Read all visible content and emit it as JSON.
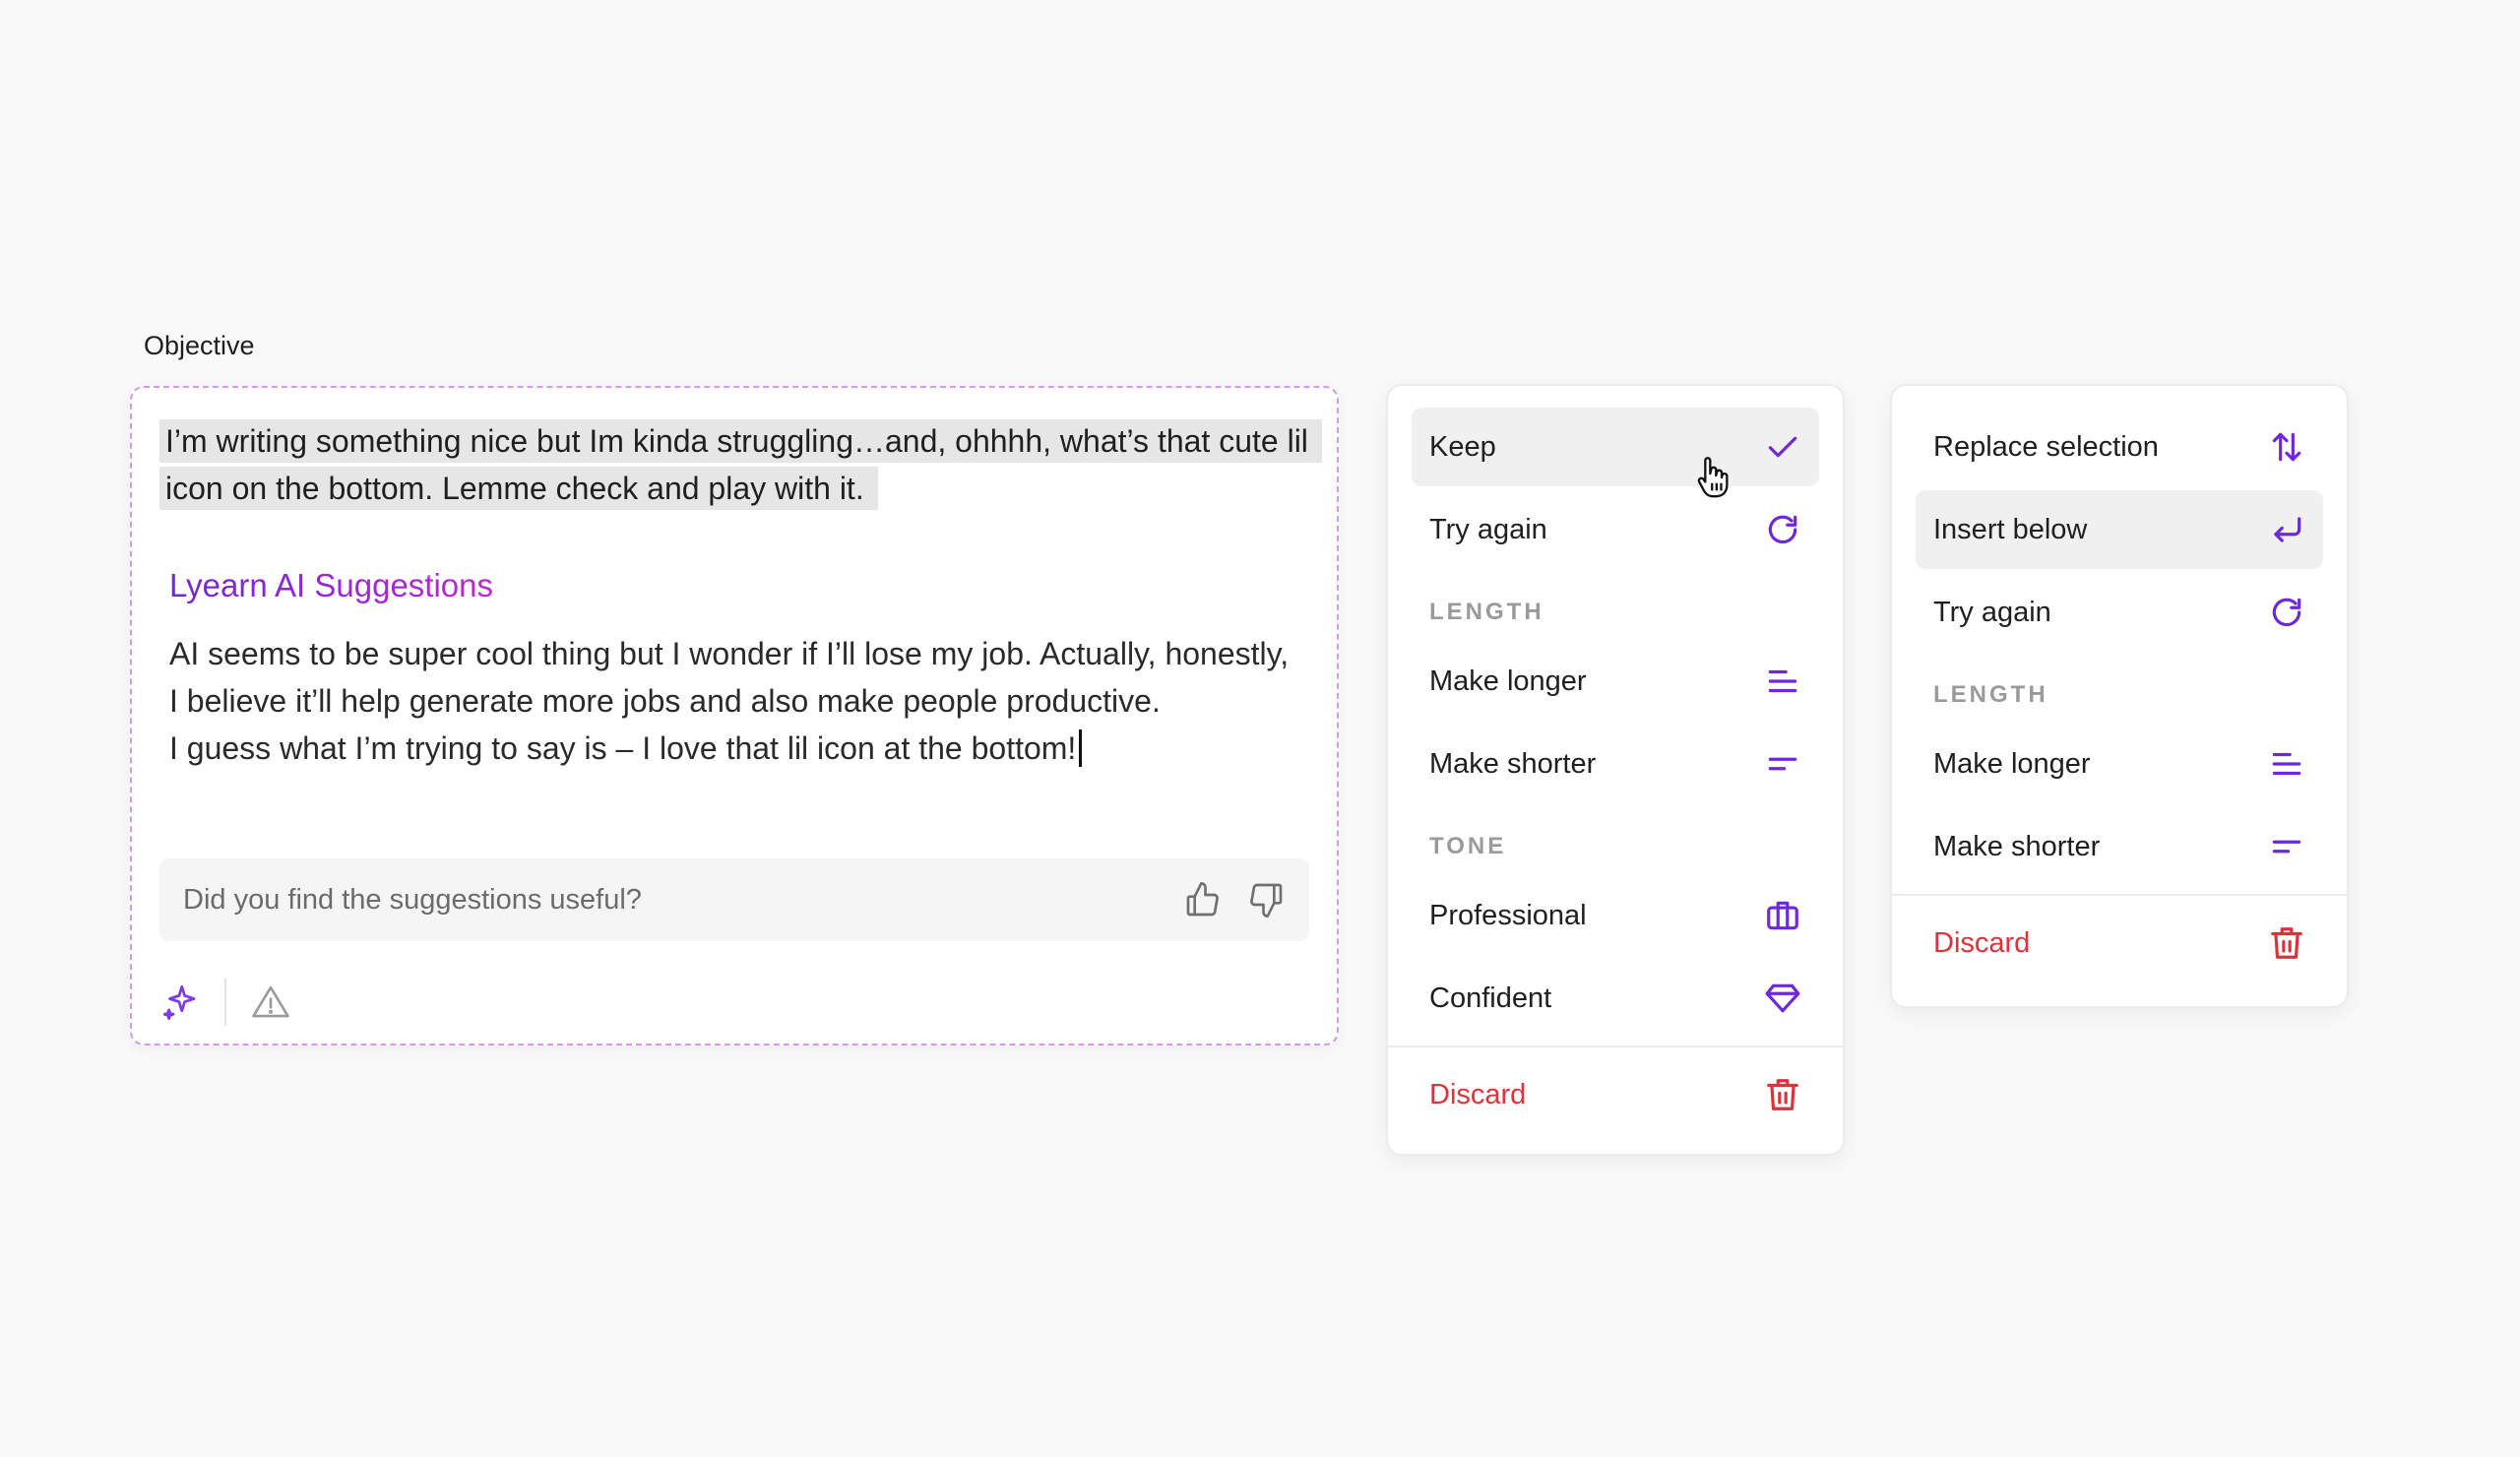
{
  "field_label": "Objective",
  "editor": {
    "selected_text": "I’m writing something nice but Im kinda struggling…and, ohhhh, what’s that cute lil icon on the bottom. Lemme check and play with it.",
    "ai_title": "Lyearn AI Suggestions",
    "ai_line1": "AI seems to be super cool thing but I wonder if I’ll lose my job. Actually, honestly, I believe it’ll help generate more jobs and also make people productive.",
    "ai_line2": "I guess what I’m trying to say is – I love that lil icon at the bottom!",
    "feedback_question": "Did you find the suggestions useful?"
  },
  "menu1": {
    "keep": "Keep",
    "try_again": "Try again",
    "length_header": "LENGTH",
    "make_longer": "Make longer",
    "make_shorter": "Make shorter",
    "tone_header": "TONE",
    "professional": "Professional",
    "confident": "Confident",
    "discard": "Discard"
  },
  "menu2": {
    "replace_selection": "Replace selection",
    "insert_below": "Insert below",
    "try_again": "Try again",
    "length_header": "LENGTH",
    "make_longer": "Make longer",
    "make_shorter": "Make shorter",
    "discard": "Discard"
  },
  "colors": {
    "accent": "#6d28d9",
    "ai_gradient_end": "#c026d3",
    "danger": "#e0303a",
    "dashed_border": "#d49ae8"
  },
  "icons": {
    "keep": "check-icon",
    "try_again": "refresh-icon",
    "make_longer": "lines-long-icon",
    "make_shorter": "lines-short-icon",
    "professional": "briefcase-icon",
    "confident": "diamond-icon",
    "discard": "trash-icon",
    "replace_selection": "swap-vertical-icon",
    "insert_below": "enter-icon",
    "ai": "sparkle-icon",
    "warning": "warning-icon",
    "thumbs_up": "thumbs-up-icon",
    "thumbs_down": "thumbs-down-icon"
  }
}
